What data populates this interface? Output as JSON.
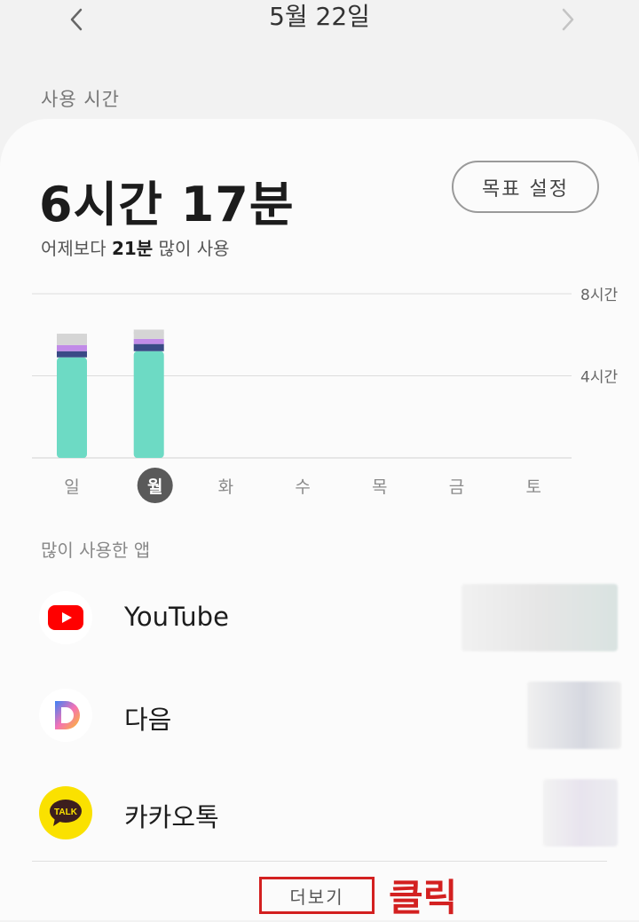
{
  "header": {
    "date": "5월 22일",
    "prev_icon": "chevron-left-icon",
    "next_icon": "chevron-right-icon"
  },
  "usage": {
    "section_label": "사용 시간",
    "total": "6시간 17분",
    "compare_prefix": "어제보다 ",
    "compare_value": "21분",
    "compare_suffix": " 많이 사용",
    "goal_button": "목표 설정"
  },
  "chart_data": {
    "type": "bar",
    "stacked": true,
    "categories": [
      "일",
      "월",
      "화",
      "수",
      "목",
      "금",
      "토"
    ],
    "selected_category": "월",
    "y_ticks": [
      "8시간",
      "4시간"
    ],
    "ylim": [
      0,
      8
    ],
    "grid": true,
    "series": [
      {
        "color": "#6ddac4",
        "values": [
          4.9,
          5.2,
          0,
          0,
          0,
          0,
          0
        ]
      },
      {
        "color": "#3a4a86",
        "values": [
          0.3,
          0.35,
          0,
          0,
          0,
          0,
          0
        ]
      },
      {
        "color": "#c18be8",
        "values": [
          0.3,
          0.25,
          0,
          0,
          0,
          0,
          0
        ]
      },
      {
        "color": "#d5d5d5",
        "values": [
          0.55,
          0.45,
          0,
          0,
          0,
          0,
          0
        ]
      }
    ]
  },
  "apps": {
    "section_label": "많이 사용한 앱",
    "items": [
      {
        "name": "YouTube",
        "icon": "youtube-icon"
      },
      {
        "name": "다음",
        "icon": "daum-icon"
      },
      {
        "name": "카카오톡",
        "icon": "kakaotalk-icon"
      }
    ]
  },
  "footer": {
    "more_button": "더보기",
    "annotation": "클릭",
    "annotation_color": "#d32020"
  }
}
